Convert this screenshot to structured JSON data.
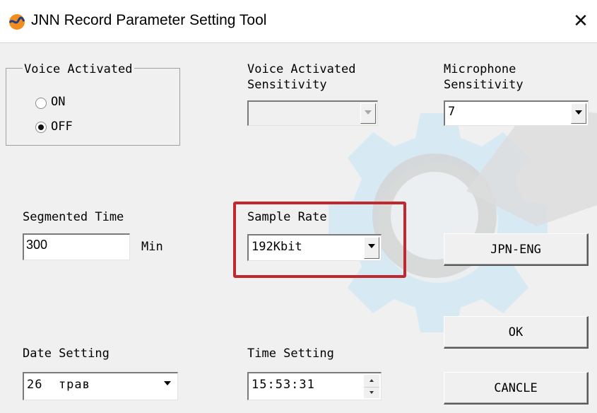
{
  "window": {
    "title": "JNN Record Parameter Setting Tool",
    "close_glyph": "✕",
    "icon": "app-logo-icon"
  },
  "voice_activated": {
    "legend": "Voice Activated",
    "on_label": "ON",
    "off_label": "OFF",
    "selected": "OFF"
  },
  "voice_sensitivity": {
    "label_line1": "Voice Activated",
    "label_line2": "Sensitivity",
    "value": "",
    "enabled": false
  },
  "mic_sensitivity": {
    "label_line1": "Microphone",
    "label_line2": "Sensitivity",
    "value": "7"
  },
  "segmented_time": {
    "label": "Segmented Time",
    "value": "300",
    "unit": "Min"
  },
  "sample_rate": {
    "label": "Sample Rate",
    "value": "192Kbit",
    "highlighted": true
  },
  "language_button": {
    "label": "JPN-ENG"
  },
  "ok_button": {
    "label": "OK"
  },
  "cancel_button": {
    "label": "CANCLE"
  },
  "date_setting": {
    "label": "Date Setting",
    "value": "26  трав"
  },
  "time_setting": {
    "label": "Time Setting",
    "value": "15:53:31"
  },
  "colors": {
    "highlight": "#c2272d",
    "background": "#f0f0f0",
    "watermark_blue": "#bfe2f5",
    "watermark_gray": "#d9d9d9"
  }
}
